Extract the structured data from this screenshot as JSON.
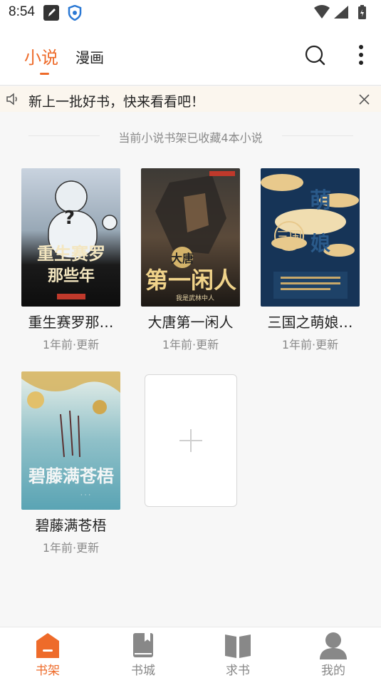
{
  "status_bar": {
    "time": "8:54"
  },
  "header": {
    "tabs": [
      {
        "label": "小说",
        "active": true
      },
      {
        "label": "漫画",
        "active": false
      }
    ]
  },
  "notice": {
    "text": "新上一批好书，快来看看吧！"
  },
  "shelf": {
    "summary": "当前小说书架已收藏4本小说",
    "books": [
      {
        "title": "重生赛罗那…",
        "meta": "1年前·更新",
        "cover_text": "重生赛罗 那些年"
      },
      {
        "title": "大唐第一闲人",
        "meta": "1年前·更新",
        "cover_text": "大唐 第一闲人"
      },
      {
        "title": "三国之萌娘…",
        "meta": "1年前·更新",
        "cover_text": "萌娘 三国"
      },
      {
        "title": "碧藤满苍梧",
        "meta": "1年前·更新",
        "cover_text": "碧藤满苍梧"
      }
    ]
  },
  "bottom_nav": [
    {
      "label": "书架",
      "icon": "bookshelf-icon",
      "active": true
    },
    {
      "label": "书城",
      "icon": "bookstore-icon",
      "active": false
    },
    {
      "label": "求书",
      "icon": "request-book-icon",
      "active": false
    },
    {
      "label": "我的",
      "icon": "profile-icon",
      "active": false
    }
  ],
  "colors": {
    "accent": "#ee6b2a",
    "notice_bg": "#fbf6ee",
    "muted": "#8a8a8a"
  }
}
